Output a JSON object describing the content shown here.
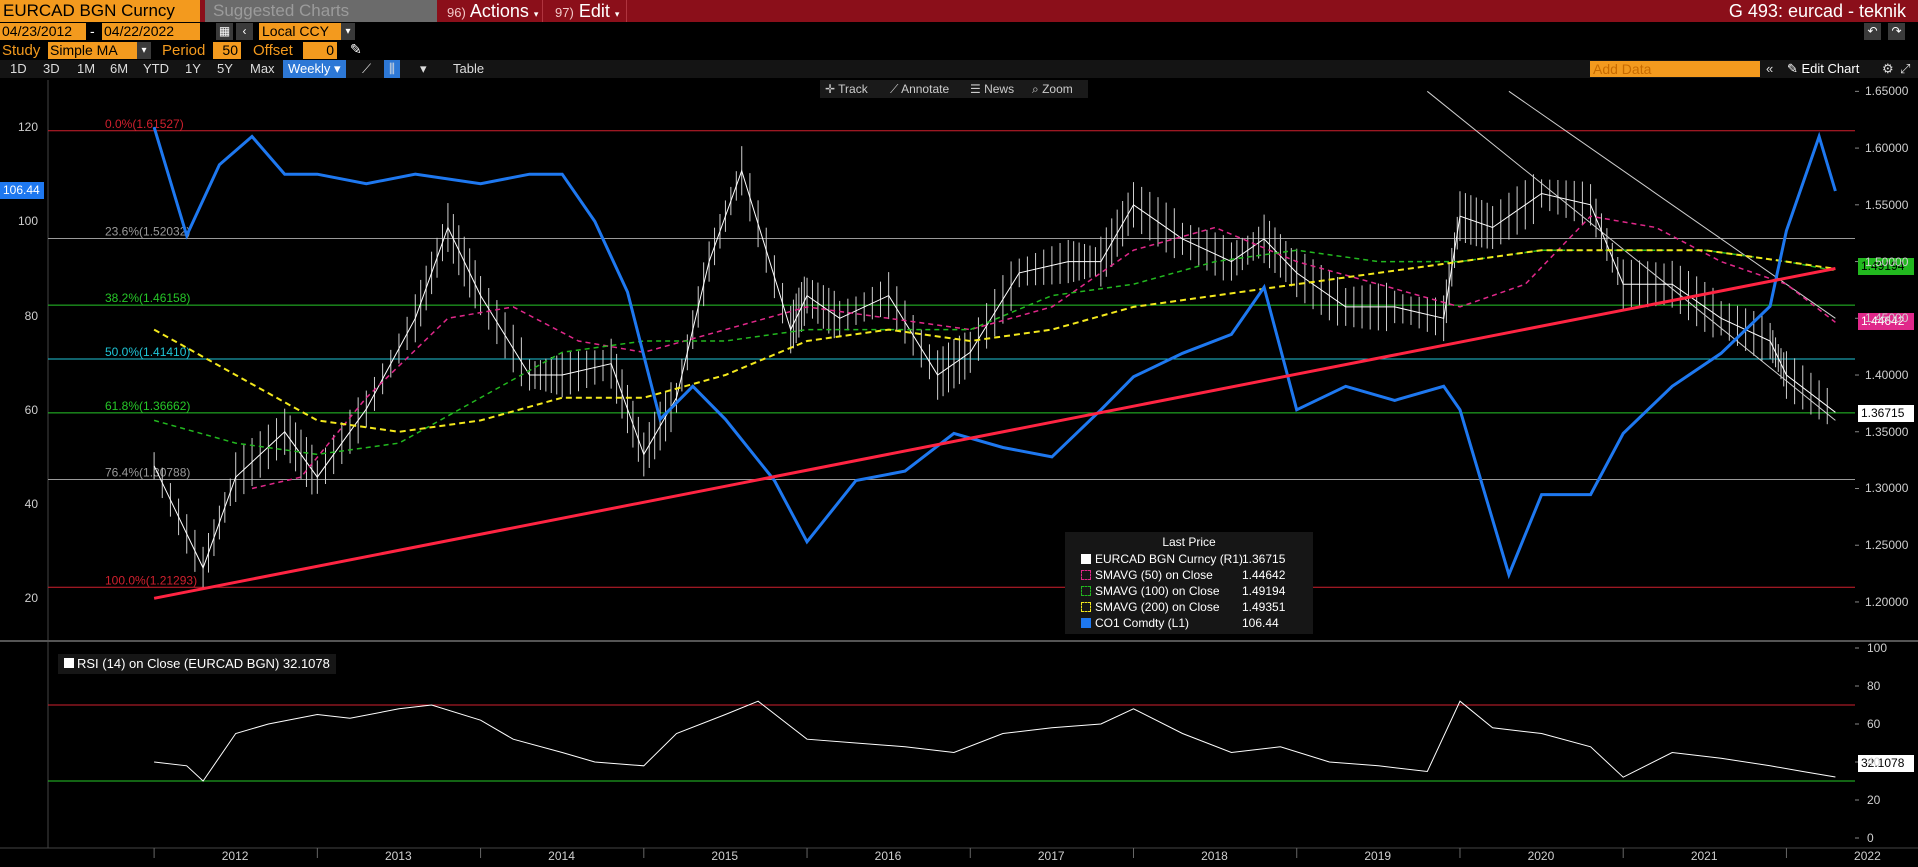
{
  "header": {
    "security": "EURCAD BGN Curncy",
    "suggested_charts": "Suggested Charts",
    "actions_num": "96)",
    "actions": "Actions",
    "edit_num": "97)",
    "edit": "Edit",
    "title": "G 493: eurcad - teknik"
  },
  "controls": {
    "start_date": "04/23/2012",
    "end_date": "04/22/2022",
    "currency": "Local CCY",
    "study_label": "Study",
    "study_value": "Simple MA",
    "period_label": "Period",
    "period_value": "50",
    "offset_label": "Offset",
    "offset_value": "0"
  },
  "timeframes": [
    "1D",
    "3D",
    "1M",
    "6M",
    "YTD",
    "1Y",
    "5Y",
    "Max"
  ],
  "periodicity": "Weekly",
  "table_label": "Table",
  "add_data_placeholder": "Add Data",
  "edit_chart": "Edit Chart",
  "chart_toolbar": {
    "track": "Track",
    "annotate": "Annotate",
    "news": "News",
    "zoom": "Zoom"
  },
  "colors": {
    "price": "#ffffff",
    "sma50": "#e0288a",
    "sma100": "#22b81f",
    "sma200": "#f3e81c",
    "brent": "#1e78f0",
    "trend": "#ff2442",
    "fib_red": "#d0202e",
    "fib_grey": "#9a9a9a",
    "fib_green": "#26c728",
    "fib_cyan": "#1fc5d6"
  },
  "chart_data": [
    {
      "type": "line",
      "x_axis": {
        "labels": [
          "2012",
          "2013",
          "2014",
          "2015",
          "2016",
          "2017",
          "2018",
          "2019",
          "2020",
          "2021",
          "2022"
        ]
      },
      "right_axis": {
        "ticks": [
          "1.65000",
          "1.60000",
          "1.55000",
          "1.50000",
          "1.45000",
          "1.40000",
          "1.35000",
          "1.30000",
          "1.25000",
          "1.20000"
        ],
        "range": [
          1.17,
          1.66
        ]
      },
      "left_axis": {
        "ticks": [
          "120",
          "100",
          "80",
          "60",
          "40",
          "20"
        ],
        "range": [
          12,
          130
        ]
      },
      "fibonacci": [
        {
          "label": "0.0%(1.61527)",
          "value": 1.61527
        },
        {
          "label": "23.6%(1.52032)",
          "value": 1.52032
        },
        {
          "label": "38.2%(1.46158)",
          "value": 1.46158
        },
        {
          "label": "50.0%(1.41410)",
          "value": 1.4141
        },
        {
          "label": "61.8%(1.36662)",
          "value": 1.36662
        },
        {
          "label": "76.4%(1.30788)",
          "value": 1.30788
        },
        {
          "label": "100.0%(1.21293)",
          "value": 1.21293
        }
      ],
      "series": [
        {
          "name": "EURCAD BGN Curncy (R1)",
          "axis": "right",
          "x": [
            2012.0,
            2012.3,
            2012.5,
            2012.8,
            2013.0,
            2013.3,
            2013.6,
            2013.8,
            2014.0,
            2014.3,
            2014.5,
            2014.8,
            2015.0,
            2015.2,
            2015.4,
            2015.6,
            2015.9,
            2016.0,
            2016.2,
            2016.5,
            2016.8,
            2017.0,
            2017.3,
            2017.6,
            2017.8,
            2018.0,
            2018.3,
            2018.6,
            2018.8,
            2019.0,
            2019.3,
            2019.6,
            2019.9,
            2020.0,
            2020.2,
            2020.5,
            2020.8,
            2021.0,
            2021.3,
            2021.6,
            2021.9,
            2022.0,
            2022.3
          ],
          "values": [
            1.32,
            1.23,
            1.31,
            1.35,
            1.31,
            1.37,
            1.45,
            1.53,
            1.47,
            1.4,
            1.4,
            1.41,
            1.33,
            1.38,
            1.5,
            1.58,
            1.44,
            1.47,
            1.45,
            1.47,
            1.4,
            1.42,
            1.49,
            1.5,
            1.5,
            1.55,
            1.52,
            1.5,
            1.52,
            1.49,
            1.46,
            1.46,
            1.45,
            1.54,
            1.53,
            1.56,
            1.55,
            1.48,
            1.48,
            1.45,
            1.43,
            1.4,
            1.36715
          ]
        },
        {
          "name": "SMAVG (50) on Close",
          "axis": "right",
          "x": [
            2012.6,
            2012.9,
            2013.3,
            2013.8,
            2014.2,
            2014.6,
            2015.0,
            2015.5,
            2016.0,
            2016.5,
            2017.0,
            2017.5,
            2018.0,
            2018.5,
            2019.0,
            2019.5,
            2020.0,
            2020.4,
            2020.8,
            2021.2,
            2021.6,
            2022.0,
            2022.3
          ],
          "values": [
            1.3,
            1.31,
            1.38,
            1.45,
            1.46,
            1.43,
            1.42,
            1.44,
            1.46,
            1.45,
            1.44,
            1.46,
            1.51,
            1.53,
            1.5,
            1.48,
            1.46,
            1.48,
            1.54,
            1.53,
            1.5,
            1.48,
            1.44642
          ]
        },
        {
          "name": "SMAVG (100) on Close",
          "axis": "right",
          "x": [
            2012.0,
            2012.5,
            2013.0,
            2013.5,
            2014.0,
            2014.5,
            2015.0,
            2015.5,
            2016.0,
            2016.5,
            2017.0,
            2017.5,
            2018.0,
            2018.5,
            2019.0,
            2019.5,
            2020.0,
            2020.5,
            2021.0,
            2021.5,
            2022.0,
            2022.3
          ],
          "values": [
            1.36,
            1.34,
            1.33,
            1.34,
            1.38,
            1.42,
            1.43,
            1.43,
            1.44,
            1.44,
            1.44,
            1.47,
            1.48,
            1.5,
            1.51,
            1.5,
            1.5,
            1.51,
            1.51,
            1.51,
            1.5,
            1.49194
          ]
        },
        {
          "name": "SMAVG (200) on Close",
          "axis": "right",
          "x": [
            2012.0,
            2012.5,
            2013.0,
            2013.5,
            2014.0,
            2014.5,
            2015.0,
            2015.5,
            2016.0,
            2016.5,
            2017.0,
            2017.5,
            2018.0,
            2018.5,
            2019.0,
            2019.5,
            2020.0,
            2020.5,
            2021.0,
            2021.5,
            2022.0,
            2022.3
          ],
          "values": [
            1.44,
            1.4,
            1.36,
            1.35,
            1.36,
            1.38,
            1.38,
            1.4,
            1.43,
            1.44,
            1.43,
            1.44,
            1.46,
            1.47,
            1.48,
            1.49,
            1.5,
            1.51,
            1.51,
            1.51,
            1.5,
            1.49351
          ]
        },
        {
          "name": "CO1 Comdty (L1)",
          "axis": "left",
          "x": [
            2012.0,
            2012.2,
            2012.4,
            2012.6,
            2012.8,
            2013.0,
            2013.3,
            2013.6,
            2014.0,
            2014.3,
            2014.5,
            2014.7,
            2014.9,
            2015.1,
            2015.3,
            2015.5,
            2015.8,
            2016.0,
            2016.3,
            2016.6,
            2016.9,
            2017.2,
            2017.5,
            2017.8,
            2018.0,
            2018.3,
            2018.6,
            2018.8,
            2019.0,
            2019.3,
            2019.6,
            2019.9,
            2020.0,
            2020.3,
            2020.5,
            2020.8,
            2021.0,
            2021.3,
            2021.6,
            2021.9,
            2022.0,
            2022.2,
            2022.3
          ],
          "values": [
            120,
            97,
            112,
            118,
            110,
            110,
            108,
            110,
            108,
            110,
            110,
            100,
            85,
            58,
            65,
            58,
            45,
            32,
            45,
            47,
            55,
            52,
            50,
            60,
            67,
            72,
            76,
            86,
            60,
            65,
            62,
            65,
            60,
            25,
            42,
            42,
            55,
            65,
            72,
            82,
            98,
            118,
            106.44
          ]
        }
      ],
      "trendline": {
        "x": [
          2012.0,
          2022.3
        ],
        "values": [
          20,
          90
        ]
      },
      "channel": [
        {
          "x": [
            2019.8,
            2022.3
          ],
          "values": [
            1.65,
            1.36
          ]
        },
        {
          "x": [
            2020.3,
            2022.3
          ],
          "values": [
            1.65,
            1.45
          ]
        }
      ]
    },
    {
      "type": "line",
      "title": "RSI (14)  on Close (EURCAD BGN) 32.1078",
      "y_ticks": [
        "100",
        "80",
        "60",
        "40",
        "20",
        "0"
      ],
      "range": [
        0,
        100
      ],
      "bands": [
        70,
        30
      ],
      "series": [
        {
          "name": "RSI (14)",
          "x": [
            2012.0,
            2012.2,
            2012.3,
            2012.5,
            2012.7,
            2013.0,
            2013.2,
            2013.5,
            2013.7,
            2014.0,
            2014.2,
            2014.5,
            2014.7,
            2015.0,
            2015.2,
            2015.5,
            2015.7,
            2016.0,
            2016.3,
            2016.6,
            2016.9,
            2017.2,
            2017.5,
            2017.8,
            2018.0,
            2018.3,
            2018.6,
            2018.9,
            2019.2,
            2019.5,
            2019.8,
            2020.0,
            2020.2,
            2020.5,
            2020.8,
            2021.0,
            2021.3,
            2021.6,
            2021.9,
            2022.1,
            2022.3
          ],
          "values": [
            40,
            38,
            30,
            55,
            60,
            65,
            63,
            68,
            70,
            62,
            52,
            45,
            40,
            38,
            55,
            65,
            72,
            52,
            50,
            48,
            45,
            55,
            58,
            60,
            68,
            55,
            45,
            48,
            40,
            38,
            35,
            72,
            58,
            55,
            48,
            32,
            45,
            42,
            38,
            35,
            32.1078
          ]
        }
      ]
    }
  ],
  "legend": {
    "title": "Last Price",
    "rows": [
      {
        "name": "EURCAD BGN Curncy  (R1)",
        "value": "1.36715",
        "color": "#ffffff"
      },
      {
        "name": "SMAVG (50)  on Close",
        "value": "1.44642",
        "color": "#e0288a"
      },
      {
        "name": "SMAVG (100)  on Close",
        "value": "1.49194",
        "color": "#22b81f"
      },
      {
        "name": "SMAVG (200)  on Close",
        "value": "1.49351",
        "color": "#f3e81c"
      },
      {
        "name": "CO1 Comdty  (L1)",
        "value": "106.44",
        "color": "#1e78f0"
      }
    ]
  },
  "tags": {
    "left_brent": "106.44",
    "r_sma100": "1.49194",
    "r_sma50": "1.44642",
    "r_price": "1.36715",
    "rsi": "32.1078"
  }
}
